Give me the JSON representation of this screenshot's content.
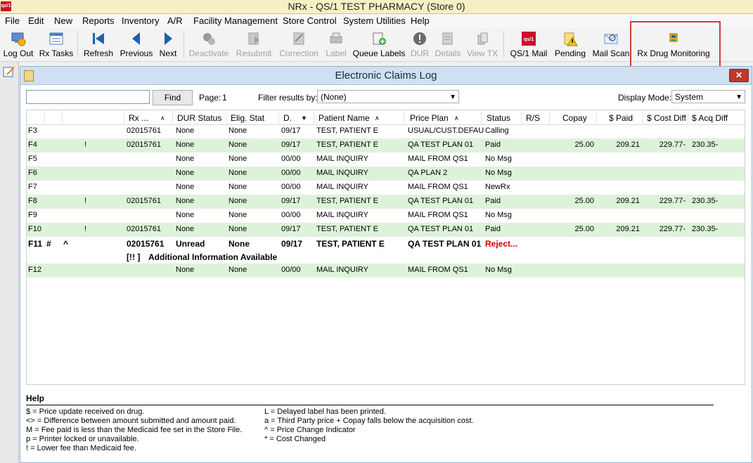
{
  "app": {
    "title": "NRx - QS/1 TEST PHARMACY (Store 0)",
    "logo": "qs/1"
  },
  "menu": [
    "File",
    "Edit",
    "New",
    "Reports",
    "Inventory",
    "A/R",
    "Facility Management",
    "Store Control",
    "System Utilities",
    "Help"
  ],
  "toolbar": [
    {
      "label": "Log Out",
      "icon": "logout-icon",
      "enabled": true
    },
    {
      "label": "Rx Tasks",
      "icon": "tasks-icon",
      "enabled": true
    },
    {
      "label": "Refresh",
      "icon": "refresh-icon",
      "enabled": true
    },
    {
      "label": "Previous",
      "icon": "previous-icon",
      "enabled": true
    },
    {
      "label": "Next",
      "icon": "next-icon",
      "enabled": true
    },
    {
      "label": "Deactivate",
      "icon": "deactivate-icon",
      "enabled": false
    },
    {
      "label": "Resubmit",
      "icon": "resubmit-icon",
      "enabled": false
    },
    {
      "label": "Correction",
      "icon": "correction-icon",
      "enabled": false
    },
    {
      "label": "Label",
      "icon": "label-icon",
      "enabled": false
    },
    {
      "label": "Queue Labels",
      "icon": "queue-labels-icon",
      "enabled": true
    },
    {
      "label": "DUR",
      "icon": "dur-icon",
      "enabled": false
    },
    {
      "label": "Details",
      "icon": "details-icon",
      "enabled": false
    },
    {
      "label": "View TX",
      "icon": "view-tx-icon",
      "enabled": false
    },
    {
      "label": "QS/1 Mail",
      "icon": "qs1-mail-icon",
      "enabled": true
    },
    {
      "label": "Pending",
      "icon": "pending-icon",
      "enabled": true
    },
    {
      "label": "Mail Scan",
      "icon": "mail-scan-icon",
      "enabled": true
    },
    {
      "label": "Rx Drug Monitoring",
      "icon": "drug-monitoring-icon",
      "enabled": true
    }
  ],
  "window": {
    "title": "Electronic Claims Log",
    "search_value": "",
    "find_label": "Find",
    "page_label": "Page:",
    "page_number": "1",
    "filter_label": "Filter results by:",
    "filter_value": "(None)",
    "display_mode_label": "Display Mode:",
    "display_mode_value": "System"
  },
  "table": {
    "headers": [
      "Rx ...",
      "DUR Status",
      "Elig. Stat",
      "D.",
      "Patient Name",
      "Price Plan",
      "Status",
      "R/S",
      "Copay",
      "$ Paid",
      "$ Cost Diff",
      "$ Acq Diff"
    ],
    "rows": [
      {
        "key": "F3",
        "flag": "",
        "mark": "",
        "rx": "02015761",
        "dur": "None",
        "elig": "None",
        "date": "09/17",
        "patient": "TEST, PATIENT E",
        "plan": "USUAL/CUST.DEFAU",
        "status": "Calling",
        "rs": "",
        "copay": "",
        "paid": "",
        "costdiff": "",
        "acqdiff": ""
      },
      {
        "key": "F4",
        "flag": "",
        "mark": "!",
        "rx": "02015761",
        "dur": "None",
        "elig": "None",
        "date": "09/17",
        "patient": "TEST, PATIENT E",
        "plan": "QA TEST PLAN 01",
        "status": "Paid",
        "rs": "",
        "copay": "25.00",
        "paid": "209.21",
        "costdiff": "229.77-",
        "acqdiff": "230.35-"
      },
      {
        "key": "F5",
        "flag": "",
        "mark": "",
        "rx": "",
        "dur": "None",
        "elig": "None",
        "date": "00/00",
        "patient": "MAIL INQUIRY",
        "plan": "MAIL FROM QS1",
        "status": "No Msg",
        "rs": "",
        "copay": "",
        "paid": "",
        "costdiff": "",
        "acqdiff": ""
      },
      {
        "key": "F6",
        "flag": "",
        "mark": "",
        "rx": "",
        "dur": "None",
        "elig": "None",
        "date": "00/00",
        "patient": "MAIL INQUIRY",
        "plan": "QA PLAN 2",
        "status": "No Msg",
        "rs": "",
        "copay": "",
        "paid": "",
        "costdiff": "",
        "acqdiff": ""
      },
      {
        "key": "F7",
        "flag": "",
        "mark": "",
        "rx": "",
        "dur": "None",
        "elig": "None",
        "date": "00/00",
        "patient": "MAIL INQUIRY",
        "plan": "MAIL FROM QS1",
        "status": "NewRx",
        "rs": "",
        "copay": "",
        "paid": "",
        "costdiff": "",
        "acqdiff": ""
      },
      {
        "key": "F8",
        "flag": "",
        "mark": "!",
        "rx": "02015761",
        "dur": "None",
        "elig": "None",
        "date": "09/17",
        "patient": "TEST, PATIENT E",
        "plan": "QA TEST PLAN 01",
        "status": "Paid",
        "rs": "",
        "copay": "25.00",
        "paid": "209.21",
        "costdiff": "229.77-",
        "acqdiff": "230.35-"
      },
      {
        "key": "F9",
        "flag": "",
        "mark": "",
        "rx": "",
        "dur": "None",
        "elig": "None",
        "date": "00/00",
        "patient": "MAIL INQUIRY",
        "plan": "MAIL FROM QS1",
        "status": "No Msg",
        "rs": "",
        "copay": "",
        "paid": "",
        "costdiff": "",
        "acqdiff": ""
      },
      {
        "key": "F10",
        "flag": "",
        "mark": "!",
        "rx": "02015761",
        "dur": "None",
        "elig": "None",
        "date": "09/17",
        "patient": "TEST, PATIENT E",
        "plan": "QA TEST PLAN 01",
        "status": "Paid",
        "rs": "",
        "copay": "25.00",
        "paid": "209.21",
        "costdiff": "229.77-",
        "acqdiff": "230.35-"
      },
      {
        "key": "F11",
        "flag": "#",
        "mark": "^",
        "rx": "02015761",
        "dur": "Unread",
        "elig": "None",
        "date": "09/17",
        "patient": "TEST, PATIENT E",
        "plan": "QA TEST PLAN 01",
        "status": "Reject...",
        "rs": "",
        "copay": "",
        "paid": "",
        "costdiff": "",
        "acqdiff": ""
      },
      {
        "key": "F12",
        "flag": "",
        "mark": "",
        "rx": "",
        "dur": "None",
        "elig": "None",
        "date": "00/00",
        "patient": "MAIL INQUIRY",
        "plan": "MAIL FROM QS1",
        "status": "No Msg",
        "rs": "",
        "copay": "",
        "paid": "",
        "costdiff": "",
        "acqdiff": ""
      }
    ],
    "info_row": {
      "icon": "[!! ]",
      "text": "Additional Information Available"
    }
  },
  "help": {
    "title": "Help",
    "left": [
      "$ = Price update received on drug.",
      "<> = Difference between amount submitted and amount paid.",
      "M = Fee paid is less than the Medicaid fee set in the Store File.",
      "p = Printer locked or unavailable.",
      "! = Lower fee than Medicaid fee."
    ],
    "right": [
      "L = Delayed label has been printed.",
      "a = Third Party price + Copay falls below the acquisition cost.",
      "^ = Price Change Indicator",
      "* = Cost Changed"
    ]
  },
  "colors": {
    "row_alt": "#ddf3d9",
    "reject": "#d00000",
    "highlight": "#d93a3a"
  }
}
